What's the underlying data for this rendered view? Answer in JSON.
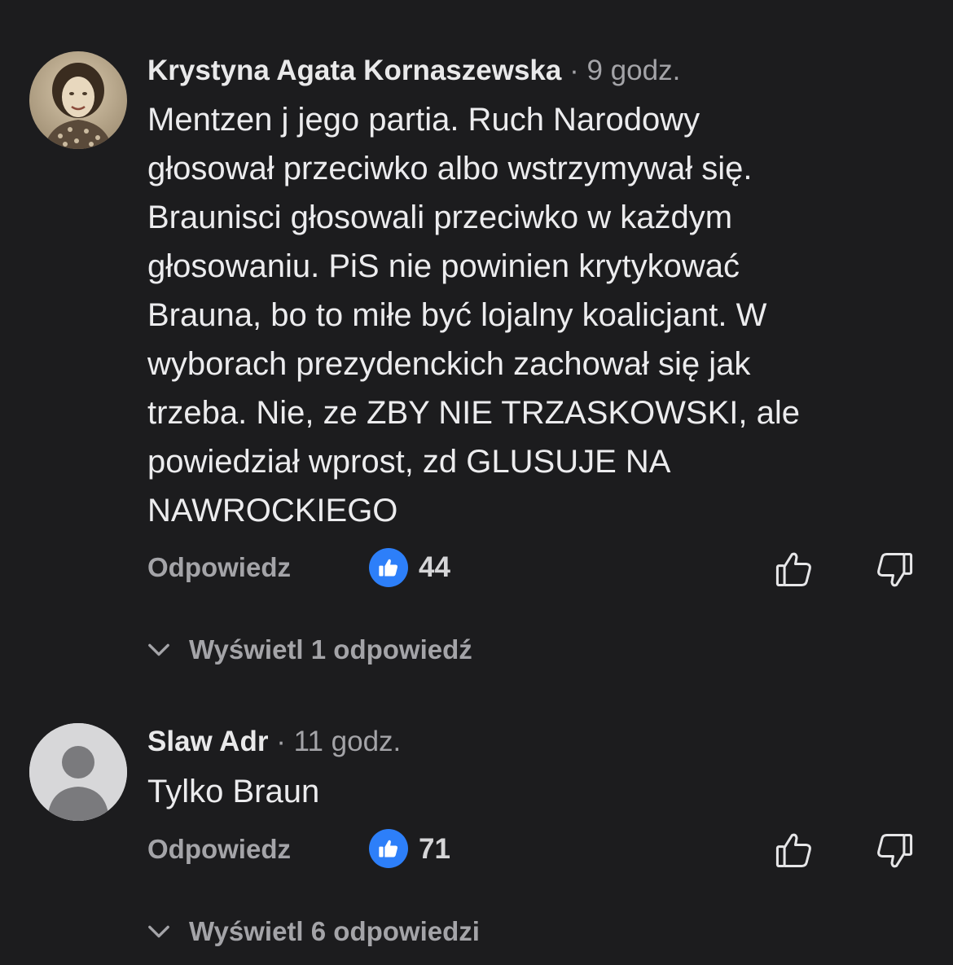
{
  "comments": [
    {
      "author": "Krystyna Agata Kornaszewska",
      "separator": "·",
      "time": "9 godz.",
      "text_lines": [
        "Mentzen j jego partia. Ruch Narodowy",
        "głosował przeciwko albo wstrzymywał się.",
        "Braunisci głosowali przeciwko w każdym",
        "głosowaniu.  PiS nie powinien krytykować",
        "Brauna,  bo to miłe być lojalny koalicjant.  W",
        "wyborach prezydenckich zachował się jak",
        "trzeba. Nie,  ze ZBY NIE TRZASKOWSKI, ale",
        "powiedział wprost, zd GLUSUJE NA",
        "NAWROCKIEGO"
      ],
      "reply_label": "Odpowiedz",
      "like_count": "44",
      "view_replies": "Wyświetl 1 odpowiedź",
      "avatar": "photo-avatar"
    },
    {
      "author": "Slaw Adr",
      "separator": "·",
      "time": "11 godz.",
      "text_lines": [
        "Tylko Braun"
      ],
      "reply_label": "Odpowiedz",
      "like_count": "71",
      "view_replies": "Wyświetl 6 odpowiedzi",
      "avatar": "default-user-avatar"
    }
  ],
  "icons": {
    "like_badge": "thumbs-up-filled-icon",
    "like": "thumbs-up-outline-icon",
    "dislike": "thumbs-down-outline-icon",
    "expand": "chevron-down-icon"
  },
  "colors": {
    "background": "#1c1c1e",
    "accent": "#2d7ff9",
    "muted_text": "#a4a4a8"
  }
}
